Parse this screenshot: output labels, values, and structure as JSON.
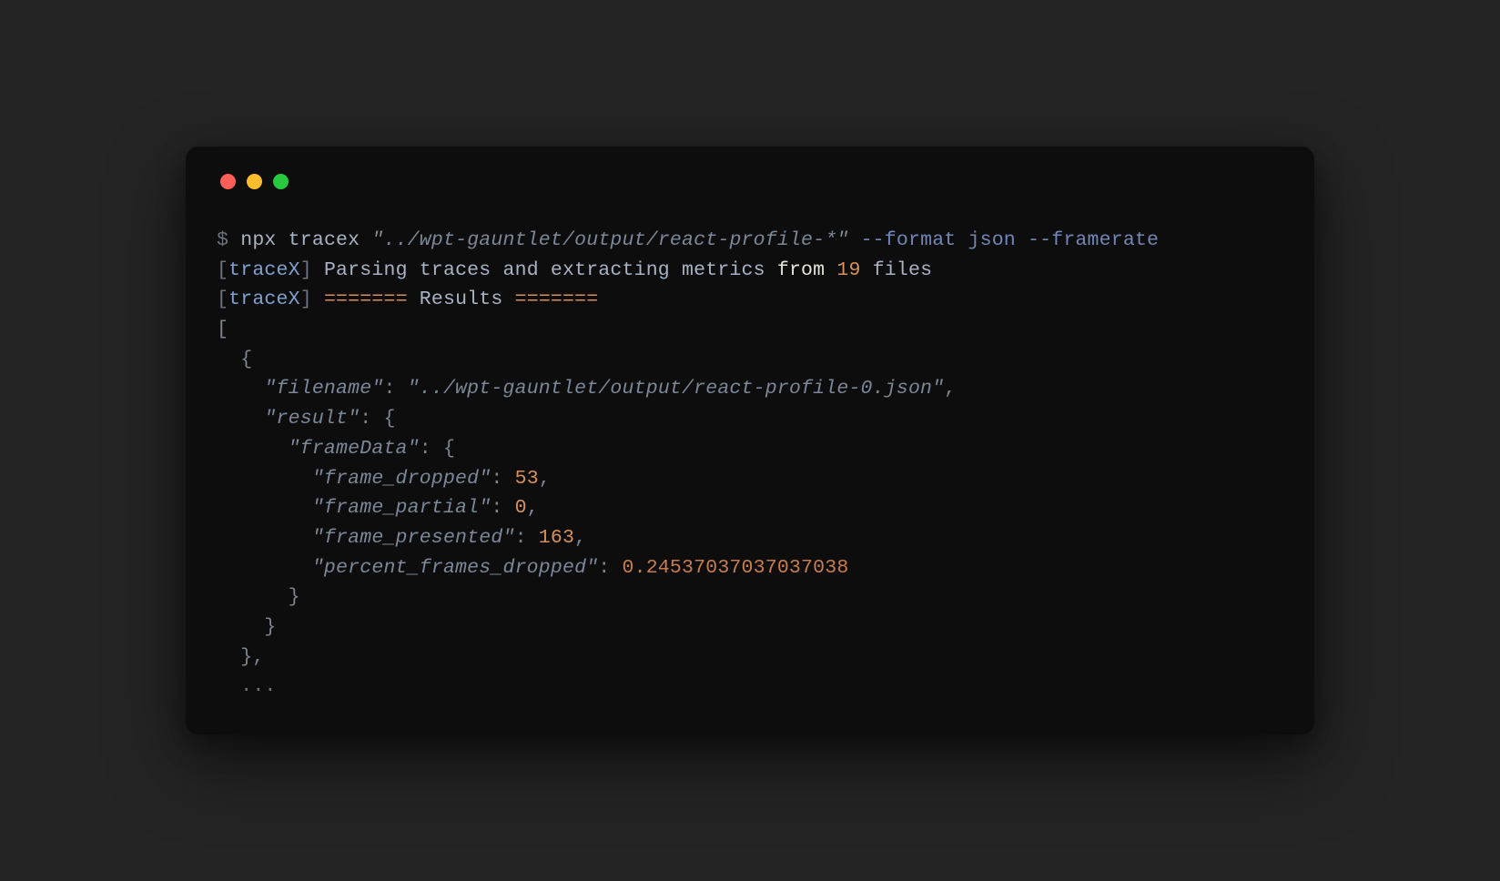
{
  "prompt": "$",
  "command": {
    "runner": "npx",
    "tool": "tracex",
    "path": "\"../wpt-gauntlet/output/react-profile-*\"",
    "flags": "--format json --framerate"
  },
  "log1": {
    "tag": "traceX",
    "prefix": "Parsing traces and extracting metrics",
    "from": "from",
    "count": "19",
    "suffix": "files"
  },
  "log2": {
    "tag": "traceX",
    "eq1": "=======",
    "label": "Results",
    "eq2": "======="
  },
  "json": {
    "filename_key": "\"filename\"",
    "filename_val": "\"../wpt-gauntlet/output/react-profile-0.json\"",
    "result_key": "\"result\"",
    "frameData_key": "\"frameData\"",
    "frame_dropped_key": "\"frame_dropped\"",
    "frame_dropped_val": "53",
    "frame_partial_key": "\"frame_partial\"",
    "frame_partial_val": "0",
    "frame_presented_key": "\"frame_presented\"",
    "frame_presented_val": "163",
    "percent_key": "\"percent_frames_dropped\"",
    "percent_val": "0.24537037037037038"
  },
  "ellipsis": "..."
}
